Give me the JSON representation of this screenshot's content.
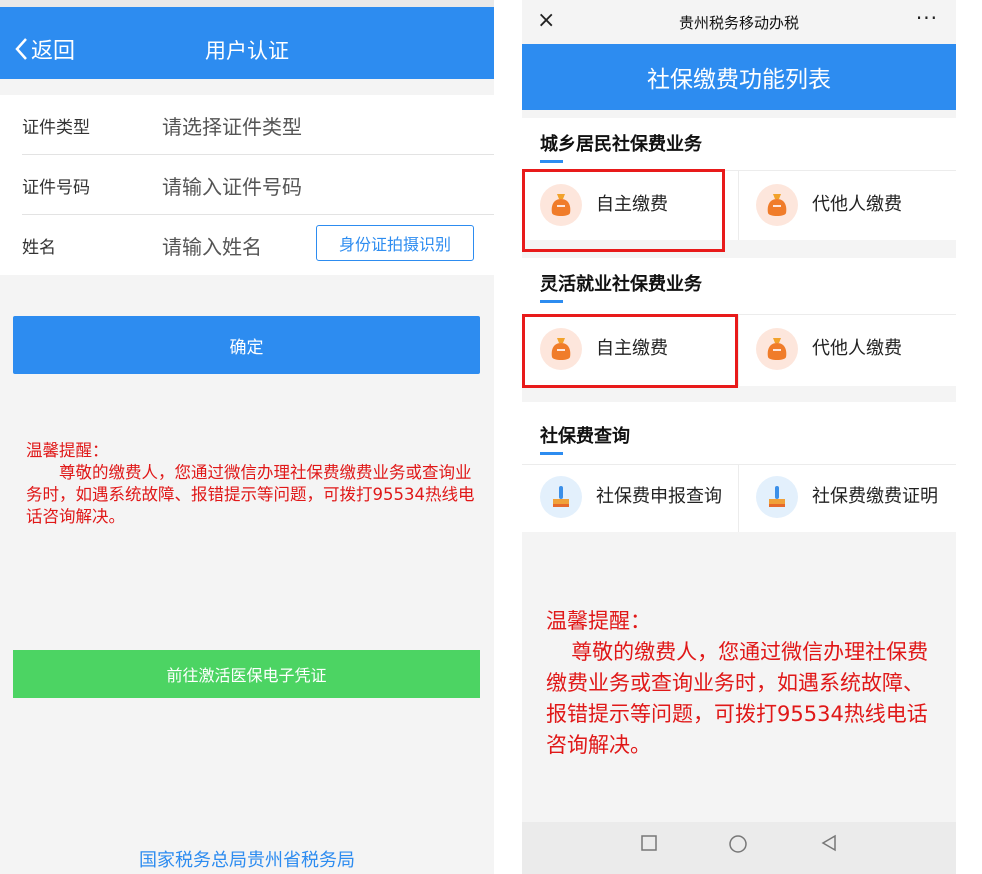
{
  "left": {
    "back_label": "返回",
    "title": "用户认证",
    "form": [
      {
        "label": "证件类型",
        "placeholder": "请选择证件类型"
      },
      {
        "label": "证件号码",
        "placeholder": "请输入证件号码"
      },
      {
        "label": "姓名",
        "placeholder": "请输入姓名"
      }
    ],
    "id_scan_button": "身份证拍摄识别",
    "confirm_button": "确定",
    "notice_title": "温馨提醒：",
    "notice_body": "尊敬的缴费人，您通过微信办理社保费缴费业务或查询业务时，如遇系统故障、报错提示等问题，可拨打95534热线电话咨询解决。",
    "activate_button": "前往激活医保电子凭证",
    "footer": "国家税务总局贵州省税务局"
  },
  "right": {
    "app_title": "贵州税务移动办税",
    "close_icon": "×",
    "more_icon": "···",
    "page_title": "社保缴费功能列表",
    "sections": [
      {
        "title": "城乡居民社保费业务",
        "items": [
          "自主缴费",
          "代他人缴费"
        ]
      },
      {
        "title": "灵活就业社保费业务",
        "items": [
          "自主缴费",
          "代他人缴费"
        ]
      },
      {
        "title": "社保费查询",
        "items": [
          "社保费申报查询",
          "社保费缴费证明"
        ]
      }
    ],
    "notice_title": "温馨提醒：",
    "notice_body": "尊敬的缴费人，您通过微信办理社保费缴费业务或查询业务时，如遇系统故障、报错提示等问题，可拨打95534热线电话咨询解决。",
    "colors": {
      "primary": "#2d8cf0",
      "highlight": "#e81a1a",
      "notice": "#e01818",
      "green": "#4cd463"
    },
    "icons": [
      "money-bag-icon",
      "query-stamp-icon"
    ]
  }
}
